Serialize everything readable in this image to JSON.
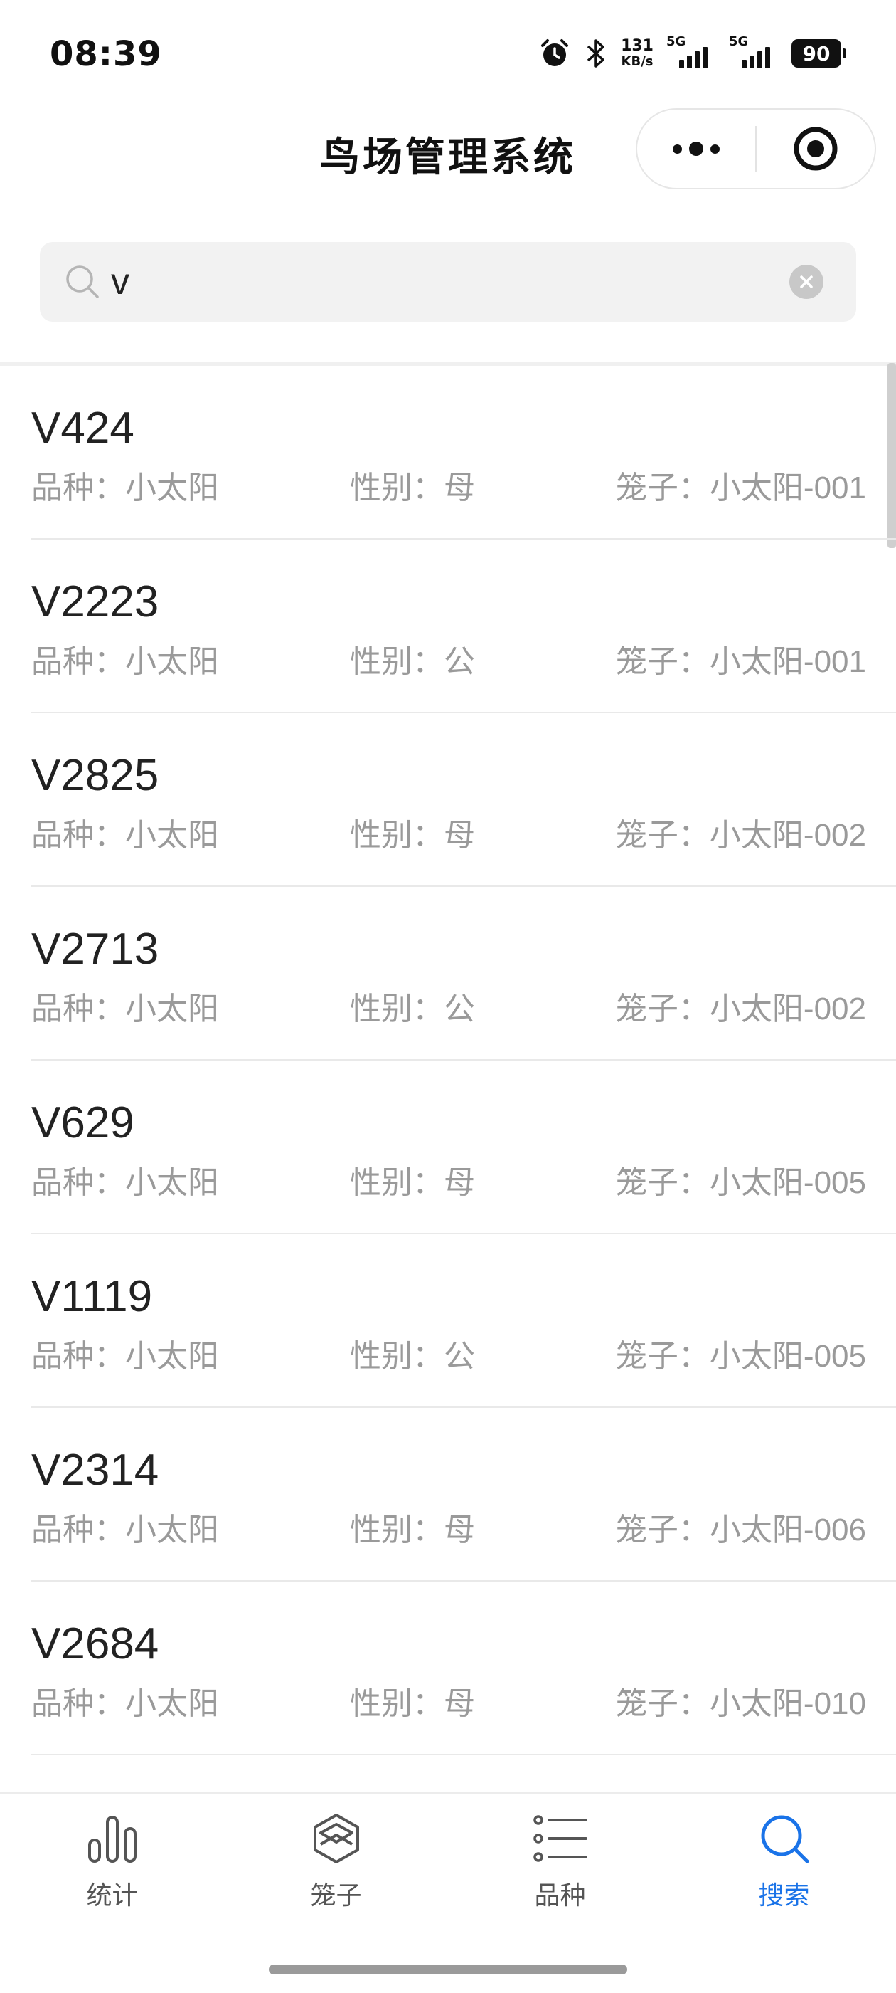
{
  "status_bar": {
    "time": "08:39",
    "net_speed_value": "131",
    "net_speed_unit": "KB/s",
    "sim1_label": "5G",
    "sim2_label": "5G",
    "battery_level": "90"
  },
  "header": {
    "title": "鸟场管理系统"
  },
  "search": {
    "value": "v",
    "placeholder": ""
  },
  "birds": [
    {
      "id": "V424",
      "breed": "品种：小太阳",
      "sex": "性别：母",
      "cage": "笼子：小太阳-001"
    },
    {
      "id": "V2223",
      "breed": "品种：小太阳",
      "sex": "性别：公",
      "cage": "笼子：小太阳-001"
    },
    {
      "id": "V2825",
      "breed": "品种：小太阳",
      "sex": "性别：母",
      "cage": "笼子：小太阳-002"
    },
    {
      "id": "V2713",
      "breed": "品种：小太阳",
      "sex": "性别：公",
      "cage": "笼子：小太阳-002"
    },
    {
      "id": "V629",
      "breed": "品种：小太阳",
      "sex": "性别：母",
      "cage": "笼子：小太阳-005"
    },
    {
      "id": "V1119",
      "breed": "品种：小太阳",
      "sex": "性别：公",
      "cage": "笼子：小太阳-005"
    },
    {
      "id": "V2314",
      "breed": "品种：小太阳",
      "sex": "性别：母",
      "cage": "笼子：小太阳-006"
    },
    {
      "id": "V2684",
      "breed": "品种：小太阳",
      "sex": "性别：母",
      "cage": "笼子：小太阳-010"
    }
  ],
  "tabs": [
    {
      "label": "统计",
      "icon": "bar-chart-icon",
      "active": false
    },
    {
      "label": "笼子",
      "icon": "cube-icon",
      "active": false
    },
    {
      "label": "品种",
      "icon": "list-icon",
      "active": false
    },
    {
      "label": "搜索",
      "icon": "search-icon",
      "active": true
    }
  ],
  "colors": {
    "accent": "#1a73e8",
    "text_primary": "#222222",
    "text_secondary": "#9a9a9a",
    "search_bg": "#f2f2f2"
  }
}
